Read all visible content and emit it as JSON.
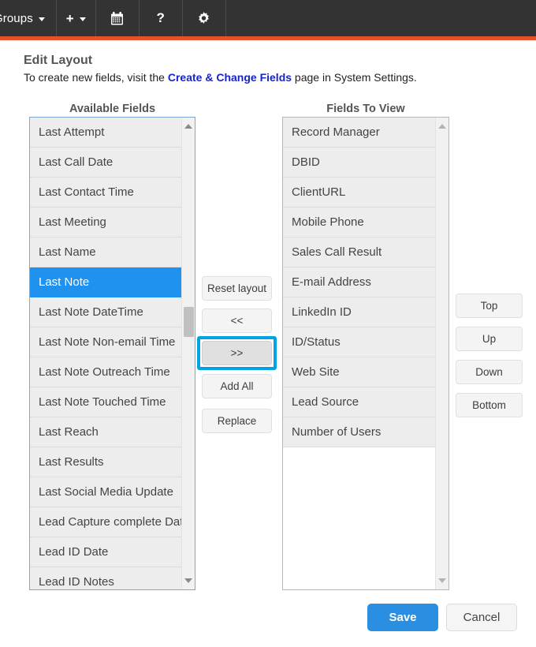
{
  "topbar": {
    "background": "#333333",
    "accent": "#e8502a",
    "items": [
      {
        "label": "Groups",
        "icon": "chevron-down-icon",
        "has_caret": true
      },
      {
        "label": "+",
        "icon": "plus-icon",
        "has_caret": true
      },
      {
        "label": "",
        "icon": "calendar-icon",
        "has_caret": false
      },
      {
        "label": "?",
        "icon": "help-icon",
        "has_caret": false
      },
      {
        "label": "",
        "icon": "gear-icon",
        "has_caret": false
      }
    ]
  },
  "page": {
    "title": "Edit Layout",
    "subtitle_before": "To create new fields, visit the ",
    "subtitle_link": "Create & Change Fields",
    "subtitle_after": " page in System Settings."
  },
  "available": {
    "heading": "Available Fields",
    "selected_index": 5,
    "items": [
      "Last Attempt",
      "Last Call Date",
      "Last Contact Time",
      "Last Meeting",
      "Last Name",
      "Last Note",
      "Last Note DateTime",
      "Last Note Non-email Time",
      "Last Note Outreach Time",
      "Last Note Touched Time",
      "Last Reach",
      "Last Results",
      "Last Social Media Update",
      "Lead Capture complete Dat",
      "Lead ID Date",
      "Lead ID Notes"
    ]
  },
  "fields_to_view": {
    "heading": "Fields To View",
    "items": [
      "Record Manager",
      "DBID",
      "ClientURL",
      "Mobile Phone",
      "Sales Call Result",
      "E-mail Address",
      "LinkedIn ID",
      "ID/Status",
      "Web Site",
      "Lead Source",
      "Number of Users"
    ]
  },
  "transfer_buttons": {
    "reset": "Reset layout",
    "move_left": "<<",
    "move_right": ">>",
    "add_all": "Add All",
    "replace": "Replace",
    "focused": "move_right",
    "focus_color": "#00a3e4"
  },
  "order_buttons": {
    "top": "Top",
    "up": "Up",
    "down": "Down",
    "bottom": "Bottom"
  },
  "footer": {
    "save": "Save",
    "cancel": "Cancel",
    "save_color": "#2a8fe0"
  }
}
